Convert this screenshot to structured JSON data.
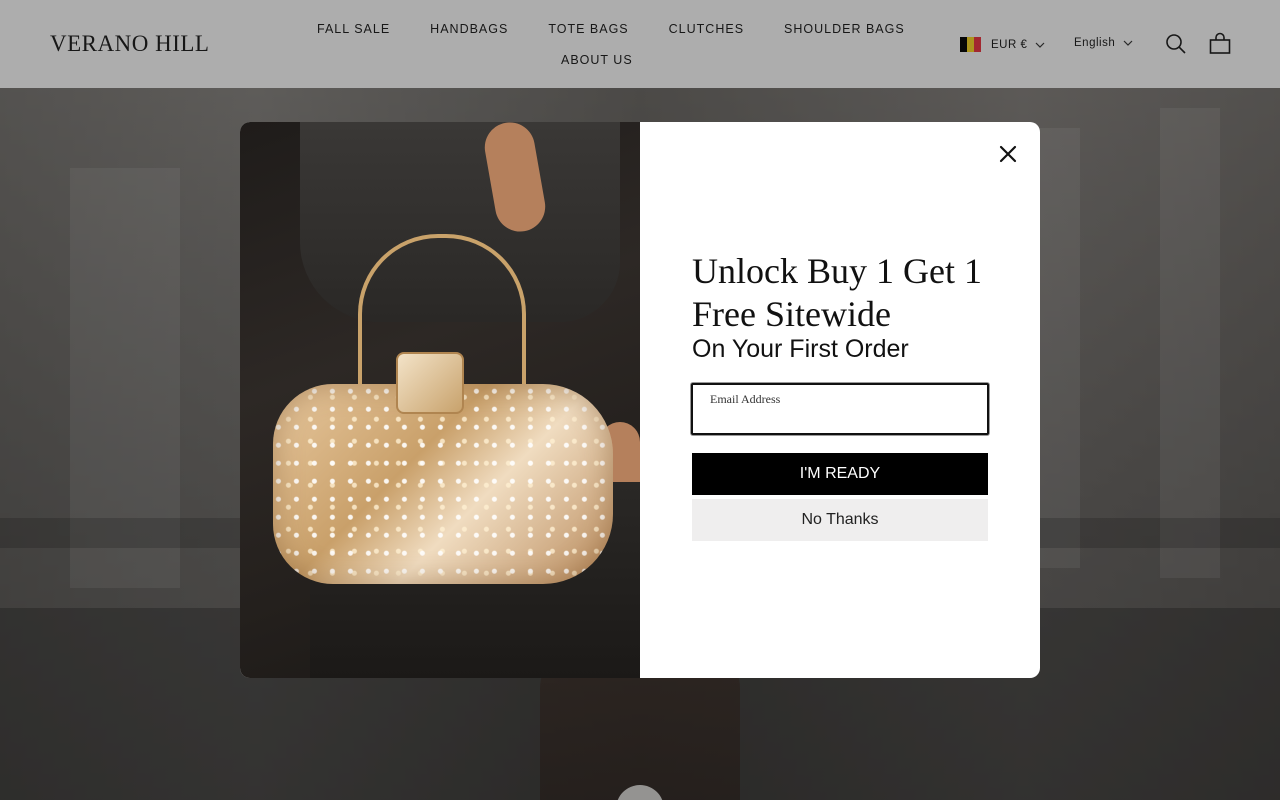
{
  "header": {
    "logo": "VERANO HILL",
    "nav_row1": [
      "FALL SALE",
      "HANDBAGS",
      "TOTE BAGS",
      "CLUTCHES",
      "SHOULDER BAGS"
    ],
    "nav_row2": [
      "ABOUT US"
    ],
    "currency": "EUR €",
    "currency_flag_colors": [
      "#000000",
      "#FDDA24",
      "#EF3340"
    ],
    "language": "English",
    "icons": [
      "search-icon",
      "shopping-bag-icon"
    ]
  },
  "popup": {
    "headline": "Unlock Buy 1 Get 1 Free Sitewide",
    "subheadline": "On Your First Order",
    "email_label": "Email Address",
    "email_value": "",
    "submit_label": "I'M READY",
    "decline_label": "No Thanks",
    "close_icon": "close-icon"
  }
}
